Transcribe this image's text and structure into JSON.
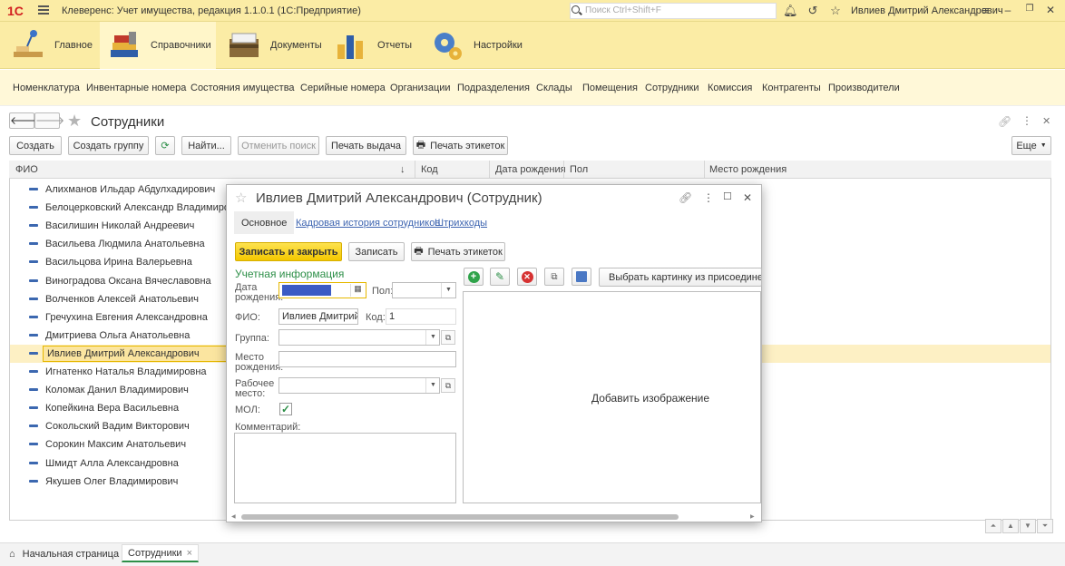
{
  "titlebar": {
    "logo": "1С",
    "title": "Клеверенс: Учет имущества, редакция 1.1.0.1  (1С:Предприятие)",
    "search_placeholder": "Поиск Ctrl+Shift+F",
    "user": "Ивлиев Дмитрий Александрович"
  },
  "sections": [
    {
      "label": "Главное",
      "icon": "desk-lamp-icon"
    },
    {
      "label": "Справочники",
      "icon": "books-icon"
    },
    {
      "label": "Документы",
      "icon": "documents-icon"
    },
    {
      "label": "Отчеты",
      "icon": "bar-chart-icon"
    },
    {
      "label": "Настройки",
      "icon": "gears-icon"
    }
  ],
  "functions": [
    "Номенклатура",
    "Инвентарные номера",
    "Состояния имущества",
    "Серийные номера",
    "Организации",
    "Подразделения",
    "Склады",
    "Помещения",
    "Сотрудники",
    "Комиссия",
    "Контрагенты",
    "Производители"
  ],
  "form": {
    "title": "Сотрудники",
    "buttons": {
      "create": "Создать",
      "create_group": "Создать группу",
      "find": "Найти...",
      "cancel_search": "Отменить поиск",
      "print_issue": "Печать выдача",
      "print_labels": "Печать этикеток",
      "more": "Еще"
    }
  },
  "table": {
    "columns": [
      "ФИО",
      "Код",
      "Дата рождения",
      "Пол",
      "Место рождения"
    ],
    "sort_indicator": "↓",
    "rows": [
      "Алихманов Ильдар Абдулхадирович",
      "Белоцерковский Александр Владимирович",
      "Василишин Николай Андреевич",
      "Васильева Людмила Анатольевна",
      "Васильцова Ирина Валерьевна",
      "Виноградова Оксана Вячеславовна",
      "Волченков Алексей Анатольевич",
      "Гречухина Евгения Александровна",
      "Дмитриева Ольга Анатольевна",
      "Ивлиев Дмитрий Александрович",
      "Игнатенко Наталья Владимировна",
      "Коломак Данил Владимирович",
      "Копейкина Вера Васильевна",
      "Сокольский Вадим Викторович",
      "Сорокин Максим Анатольевич",
      "Шмидт Алла Александровна",
      "Якушев Олег Владимирович"
    ],
    "selected_index": 9
  },
  "dialog": {
    "title": "Ивлиев Дмитрий Александрович (Сотрудник)",
    "tabs": [
      "Основное",
      "Кадровая история сотрудников",
      "Штрихкоды"
    ],
    "save_close": "Записать и закрыть",
    "save": "Записать",
    "print_labels": "Печать этикеток",
    "group_title": "Учетная информация",
    "labels": {
      "birth_date_1": "Дата",
      "birth_date_2": "рождения:",
      "gender": "Пол:",
      "fio": "ФИО:",
      "code": "Код:",
      "group": "Группа:",
      "birthplace_1": "Место",
      "birthplace_2": "рождения:",
      "workplace_1": "Рабочее",
      "workplace_2": "место:",
      "mol": "МОЛ:",
      "comment": "Комментарий:"
    },
    "values": {
      "fio": "Ивлиев Дмитрий А",
      "code": "1",
      "mol_checked": true
    },
    "image_toolbar_button": "Выбрать картинку из присоединенных",
    "image_placeholder": "Добавить изображение"
  },
  "taskbar": {
    "home": "Начальная страница",
    "tab": "Сотрудники"
  },
  "colors": {
    "accent": "#fbeca5",
    "primary_button": "#f4c800",
    "link": "#3d64b0",
    "group_title": "#2d8f48"
  }
}
